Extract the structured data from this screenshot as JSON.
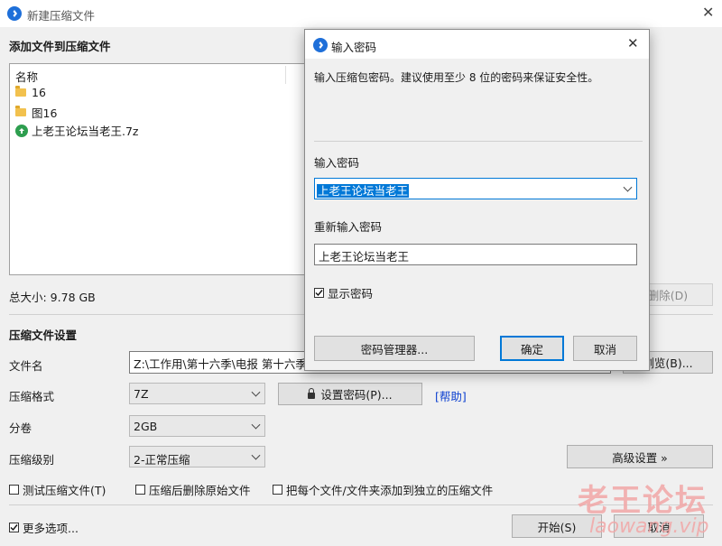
{
  "window": {
    "title": "新建压缩文件"
  },
  "main": {
    "section_add": "添加文件到压缩文件",
    "file_list_header": "名称",
    "files": [
      {
        "name": "16",
        "icon": "folder-icon"
      },
      {
        "name": "图16",
        "icon": "folder-icon"
      },
      {
        "name": "上老王论坛当老王.7z",
        "icon": "archive-icon"
      }
    ],
    "total_size": "总大小: 9.78 GB",
    "delete_button": "删除(D)",
    "section_settings": "压缩文件设置",
    "filename_label": "文件名",
    "filename_value": "Z:\\工作用\\第十六季\\电报 第十六季",
    "browse_button": "浏览(B)...",
    "format_label": "压缩格式",
    "format_value": "7Z",
    "set_password_button": "设置密码(P)...",
    "help_link": "[帮助]",
    "volume_label": "分卷",
    "volume_value": "2GB",
    "level_label": "压缩级别",
    "level_value": "2-正常压缩",
    "advanced_button": "高级设置 »",
    "opt_test": "测试压缩文件(T)",
    "opt_delete_source": "压缩后删除原始文件",
    "opt_each_separate": "把每个文件/文件夹添加到独立的压缩文件",
    "more_options": "更多选项...",
    "start_button": "开始(S)",
    "cancel_button": "取消"
  },
  "dialog": {
    "title": "输入密码",
    "description": "输入压缩包密码。建议使用至少 8 位的密码来保证安全性。",
    "password_label": "输入密码",
    "password_value": "上老王论坛当老王",
    "confirm_label": "重新输入密码",
    "confirm_value": "上老王论坛当老王",
    "show_password": "显示密码",
    "manager_button": "密码管理器...",
    "ok_button": "确定",
    "cancel_button": "取消"
  },
  "watermark": {
    "line1": "老王论坛",
    "line2": "laowang.vip"
  },
  "colors": {
    "accent": "#0078d7",
    "link": "#0b3fd0",
    "selection": "#0078d7"
  }
}
